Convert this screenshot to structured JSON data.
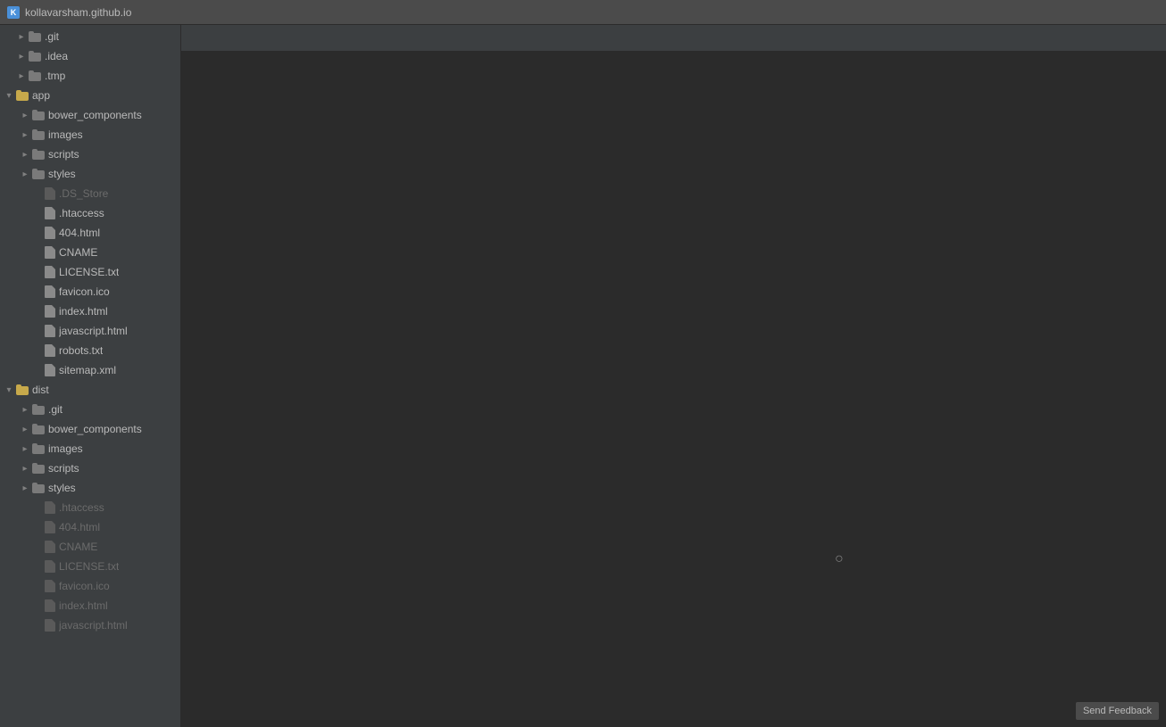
{
  "titlebar": {
    "title": "kollavarsham.github.io",
    "icon_label": "K"
  },
  "sidebar": {
    "items": [
      {
        "id": "git-root",
        "label": ".git",
        "type": "folder",
        "indent": 1,
        "arrow": "closed",
        "depth": 0,
        "dimmed": false
      },
      {
        "id": "idea",
        "label": ".idea",
        "type": "folder",
        "indent": 1,
        "arrow": "closed",
        "depth": 0,
        "dimmed": false
      },
      {
        "id": "tmp",
        "label": ".tmp",
        "type": "folder",
        "indent": 1,
        "arrow": "closed",
        "depth": 0,
        "dimmed": false
      },
      {
        "id": "app",
        "label": "app",
        "type": "folder",
        "indent": 0,
        "arrow": "open",
        "depth": 0,
        "dimmed": false
      },
      {
        "id": "bower_components_app",
        "label": "bower_components",
        "type": "folder",
        "indent": 1,
        "arrow": "closed",
        "depth": 1,
        "dimmed": false
      },
      {
        "id": "images_app",
        "label": "images",
        "type": "folder",
        "indent": 1,
        "arrow": "closed",
        "depth": 1,
        "dimmed": false
      },
      {
        "id": "scripts_app",
        "label": "scripts",
        "type": "folder",
        "indent": 1,
        "arrow": "closed",
        "depth": 1,
        "dimmed": false
      },
      {
        "id": "styles_app",
        "label": "styles",
        "type": "folder",
        "indent": 1,
        "arrow": "closed",
        "depth": 1,
        "dimmed": false
      },
      {
        "id": "ds_store",
        "label": ".DS_Store",
        "type": "file",
        "indent": 2,
        "depth": 1,
        "dimmed": true
      },
      {
        "id": "htaccess",
        "label": ".htaccess",
        "type": "file",
        "indent": 2,
        "depth": 1,
        "dimmed": false
      },
      {
        "id": "404html",
        "label": "404.html",
        "type": "file",
        "indent": 2,
        "depth": 1,
        "dimmed": false
      },
      {
        "id": "cname",
        "label": "CNAME",
        "type": "file",
        "indent": 2,
        "depth": 1,
        "dimmed": false
      },
      {
        "id": "license_txt",
        "label": "LICENSE.txt",
        "type": "file",
        "indent": 2,
        "depth": 1,
        "dimmed": false
      },
      {
        "id": "favicon_ico",
        "label": "favicon.ico",
        "type": "file",
        "indent": 2,
        "depth": 1,
        "dimmed": false
      },
      {
        "id": "index_html",
        "label": "index.html",
        "type": "file",
        "indent": 2,
        "depth": 1,
        "dimmed": false
      },
      {
        "id": "javascript_html",
        "label": "javascript.html",
        "type": "file",
        "indent": 2,
        "depth": 1,
        "dimmed": false
      },
      {
        "id": "robots_txt",
        "label": "robots.txt",
        "type": "file",
        "indent": 2,
        "depth": 1,
        "dimmed": false
      },
      {
        "id": "sitemap_xml",
        "label": "sitemap.xml",
        "type": "file",
        "indent": 2,
        "depth": 1,
        "dimmed": false
      },
      {
        "id": "dist",
        "label": "dist",
        "type": "folder",
        "indent": 0,
        "arrow": "open",
        "depth": 0,
        "dimmed": false
      },
      {
        "id": "git_dist",
        "label": ".git",
        "type": "folder",
        "indent": 1,
        "arrow": "closed",
        "depth": 1,
        "dimmed": false
      },
      {
        "id": "bower_components_dist",
        "label": "bower_components",
        "type": "folder",
        "indent": 1,
        "arrow": "closed",
        "depth": 1,
        "dimmed": false
      },
      {
        "id": "images_dist",
        "label": "images",
        "type": "folder",
        "indent": 1,
        "arrow": "closed",
        "depth": 1,
        "dimmed": false
      },
      {
        "id": "scripts_dist",
        "label": "scripts",
        "type": "folder",
        "indent": 1,
        "arrow": "closed",
        "depth": 1,
        "dimmed": false
      },
      {
        "id": "styles_dist",
        "label": "styles",
        "type": "folder",
        "indent": 1,
        "arrow": "closed",
        "depth": 1,
        "dimmed": false
      },
      {
        "id": "htaccess_dist",
        "label": ".htaccess",
        "type": "file",
        "indent": 2,
        "depth": 1,
        "dimmed": true
      },
      {
        "id": "404html_dist",
        "label": "404.html",
        "type": "file",
        "indent": 2,
        "depth": 1,
        "dimmed": true
      },
      {
        "id": "cname_dist",
        "label": "CNAME",
        "type": "file",
        "indent": 2,
        "depth": 1,
        "dimmed": true
      },
      {
        "id": "license_txt_dist",
        "label": "LICENSE.txt",
        "type": "file",
        "indent": 2,
        "depth": 1,
        "dimmed": true
      },
      {
        "id": "favicon_ico_dist",
        "label": "favicon.ico",
        "type": "file",
        "indent": 2,
        "depth": 1,
        "dimmed": true
      },
      {
        "id": "index_html_dist",
        "label": "index.html",
        "type": "file",
        "indent": 2,
        "depth": 1,
        "dimmed": true
      },
      {
        "id": "javascript_html_dist",
        "label": "javascript.html",
        "type": "file",
        "indent": 2,
        "depth": 1,
        "dimmed": true
      }
    ]
  },
  "feedback": {
    "label": "Send Feedback"
  }
}
